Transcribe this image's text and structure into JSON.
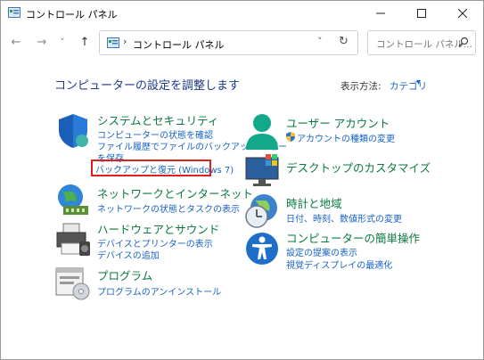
{
  "window": {
    "title": "コントロール パネル"
  },
  "nav": {
    "back": "←",
    "forward": "→",
    "recent": "˅",
    "up": "↑"
  },
  "address": {
    "separator": "›",
    "path": "コントロール パネル",
    "dropdown": "˅",
    "refresh": "↻"
  },
  "search": {
    "placeholder": "コントロール パネル..."
  },
  "header": {
    "title": "コンピューターの設定を調整します",
    "view_by_label": "表示方法:",
    "view_by_value": "カテゴリ",
    "view_by_arrow": "▾"
  },
  "categories": [
    {
      "title": "システムとセキュリティ",
      "links": [
        "コンピューターの状態を確認",
        "ファイル履歴でファイルのバックアップ コピー",
        "を保存",
        "バックアップと復元 (Windows 7)"
      ]
    },
    {
      "title": "ネットワークとインターネット",
      "links": [
        "ネットワークの状態とタスクの表示"
      ]
    },
    {
      "title": "ハードウェアとサウンド",
      "links": [
        "デバイスとプリンターの表示",
        "デバイスの追加"
      ]
    },
    {
      "title": "プログラム",
      "links": [
        "プログラムのアンインストール"
      ]
    },
    {
      "title": "ユーザー アカウント",
      "links": [
        "アカウントの種類の変更"
      ]
    },
    {
      "title": "デスクトップのカスタマイズ",
      "links": []
    },
    {
      "title": "時計と地域",
      "links": [
        "日付、時刻、数値形式の変更"
      ]
    },
    {
      "title": "コンピューターの簡単操作",
      "links": [
        "設定の提案の表示",
        "視覚ディスプレイの最適化"
      ]
    }
  ],
  "colors": {
    "category_title": "#0a7a41",
    "link": "#1763c4",
    "highlight": "#e02020",
    "heading": "#1e3a8a"
  }
}
